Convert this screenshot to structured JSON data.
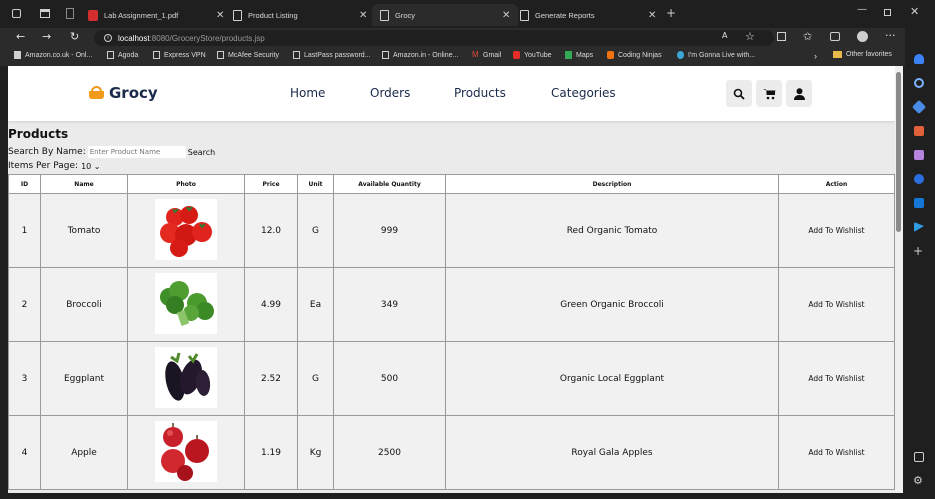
{
  "browser": {
    "tabs": [
      {
        "title": "Lab Assignment_1.pdf",
        "active": false
      },
      {
        "title": "Product Listing",
        "active": false
      },
      {
        "title": "Grocy",
        "active": true
      },
      {
        "title": "Generate Reports",
        "active": false
      }
    ],
    "url_host": "localhost",
    "url_path": ":8080/GroceryStore/products.jsp",
    "bookmarks": [
      "Amazon.co.uk - Onl...",
      "Agoda",
      "Express VPN",
      "McAfee Security",
      "LastPass password...",
      "Amazon.in - Online...",
      "Gmail",
      "YouTube",
      "Maps",
      "Coding Ninjas",
      "I'm Gonna Live with..."
    ],
    "other_favorites": "Other favorites"
  },
  "site": {
    "logo": "Grocy",
    "nav": [
      "Home",
      "Orders",
      "Products",
      "Categories"
    ]
  },
  "page": {
    "title": "Products",
    "search_label": "Search By Name:",
    "search_placeholder": "Enter Product Name",
    "search_button": "Search",
    "items_per_page_label": "Items Per Page:",
    "items_per_page_value": "10"
  },
  "table": {
    "headers": [
      "ID",
      "Name",
      "Photo",
      "Price",
      "Unit",
      "Available Quantity",
      "Description",
      "Action"
    ],
    "rows": [
      {
        "id": "1",
        "name": "Tomato",
        "photo": "tomato",
        "price": "12.0",
        "unit": "G",
        "qty": "999",
        "description": "Red Organic Tomato",
        "action": "Add To Wishlist"
      },
      {
        "id": "2",
        "name": "Broccoli",
        "photo": "broccoli",
        "price": "4.99",
        "unit": "Ea",
        "qty": "349",
        "description": "Green Organic Broccoli",
        "action": "Add To Wishlist"
      },
      {
        "id": "3",
        "name": "Eggplant",
        "photo": "eggplant",
        "price": "2.52",
        "unit": "G",
        "qty": "500",
        "description": "Organic Local Eggplant",
        "action": "Add To Wishlist"
      },
      {
        "id": "4",
        "name": "Apple",
        "photo": "apple",
        "price": "1.19",
        "unit": "Kg",
        "qty": "2500",
        "description": "Royal Gala Apples",
        "action": "Add To Wishlist"
      }
    ]
  },
  "colors": {
    "brand_orange": "#f29a1b",
    "brand_navy": "#1a2a4a"
  }
}
